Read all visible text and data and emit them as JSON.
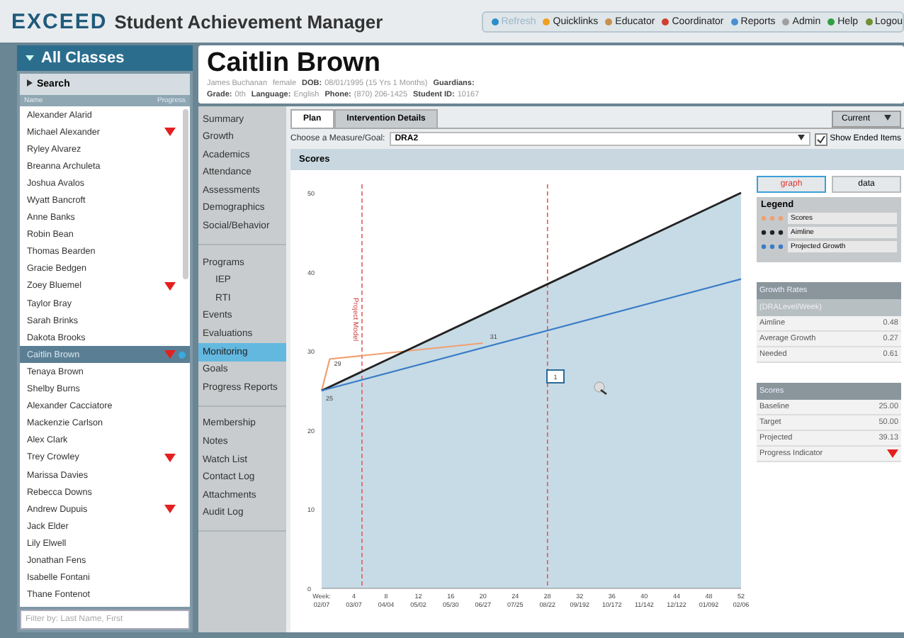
{
  "app": {
    "logo": "EXCEED",
    "title": "Student Achievement Manager"
  },
  "toolbar": [
    {
      "label": "Refresh",
      "disabled": true,
      "color": "#2a8fc8"
    },
    {
      "label": "Quicklinks",
      "disabled": false,
      "color": "#f0a020"
    },
    {
      "label": "Educator",
      "disabled": false,
      "color": "#c89050"
    },
    {
      "label": "Coordinator",
      "disabled": false,
      "color": "#d04030"
    },
    {
      "label": "Reports",
      "disabled": false,
      "color": "#4a90d0"
    },
    {
      "label": "Admin",
      "disabled": false,
      "color": "#a0a0a0"
    },
    {
      "label": "Help",
      "disabled": false,
      "color": "#30a040"
    },
    {
      "label": "Logou",
      "disabled": false,
      "color": "#709030"
    }
  ],
  "sidebar": {
    "title": "All Classes",
    "search": "Search",
    "columns": [
      "Name",
      "Progress"
    ],
    "students": [
      {
        "name": "Alexander Alarid",
        "progress_down": false,
        "selected": false
      },
      {
        "name": "Michael Alexander",
        "progress_down": true,
        "selected": false
      },
      {
        "name": "Ryley Alvarez",
        "progress_down": false,
        "selected": false
      },
      {
        "name": "Breanna Archuleta",
        "progress_down": false,
        "selected": false
      },
      {
        "name": "Joshua Avalos",
        "progress_down": false,
        "selected": false
      },
      {
        "name": "Wyatt Bancroft",
        "progress_down": false,
        "selected": false
      },
      {
        "name": "Anne Banks",
        "progress_down": false,
        "selected": false
      },
      {
        "name": "Robin Bean",
        "progress_down": false,
        "selected": false
      },
      {
        "name": "Thomas Bearden",
        "progress_down": false,
        "selected": false
      },
      {
        "name": "Gracie Bedgen",
        "progress_down": false,
        "selected": false
      },
      {
        "name": "Zoey Bluemel",
        "progress_down": true,
        "selected": false
      },
      {
        "name": "Taylor Bray",
        "progress_down": false,
        "selected": false
      },
      {
        "name": "Sarah Brinks",
        "progress_down": false,
        "selected": false
      },
      {
        "name": "Dakota Brooks",
        "progress_down": false,
        "selected": false
      },
      {
        "name": "Caitlin Brown",
        "progress_down": true,
        "selected": true
      },
      {
        "name": "Tenaya Brown",
        "progress_down": false,
        "selected": false
      },
      {
        "name": "Shelby Burns",
        "progress_down": false,
        "selected": false
      },
      {
        "name": "Alexander Cacciatore",
        "progress_down": false,
        "selected": false
      },
      {
        "name": "Mackenzie Carlson",
        "progress_down": false,
        "selected": false
      },
      {
        "name": "Alex Clark",
        "progress_down": false,
        "selected": false
      },
      {
        "name": "Trey Crowley",
        "progress_down": true,
        "selected": false
      },
      {
        "name": "Marissa Davies",
        "progress_down": false,
        "selected": false
      },
      {
        "name": "Rebecca Downs",
        "progress_down": false,
        "selected": false
      },
      {
        "name": "Andrew Dupuis",
        "progress_down": true,
        "selected": false
      },
      {
        "name": "Jack Elder",
        "progress_down": false,
        "selected": false
      },
      {
        "name": "Lily Elwell",
        "progress_down": false,
        "selected": false
      },
      {
        "name": "Jonathan Fens",
        "progress_down": false,
        "selected": false
      },
      {
        "name": "Isabelle Fontani",
        "progress_down": false,
        "selected": false
      },
      {
        "name": "Thane Fontenot",
        "progress_down": false,
        "selected": false
      }
    ],
    "filter": {
      "placeholder": "Filter by: Last Name, First"
    }
  },
  "student": {
    "name": "Caitlin Brown",
    "info": [
      [
        {
          "value": "James Buchanan"
        },
        {
          "value": "female"
        },
        {
          "label": "DOB:",
          "value": "08/01/1995 (15 Yrs 1 Months)"
        },
        {
          "label": "Guardians:"
        }
      ],
      [
        {
          "label": "Grade:",
          "value": "0th"
        },
        {
          "label": "Language:",
          "value": "English"
        },
        {
          "label": "Phone:",
          "value": "(870) 206-1425"
        },
        {
          "label": "Student ID:",
          "value": "10167"
        }
      ]
    ]
  },
  "nav": [
    [
      {
        "label": "Summary",
        "selected": false,
        "indent": false
      },
      {
        "label": "Growth",
        "selected": false,
        "indent": false
      },
      {
        "label": "Academics",
        "selected": false,
        "indent": false
      },
      {
        "label": "Attendance",
        "selected": false,
        "indent": false
      },
      {
        "label": "Assessments",
        "selected": false,
        "indent": false
      },
      {
        "label": "Demographics",
        "selected": false,
        "indent": false
      },
      {
        "label": "Social/Behavior",
        "selected": false,
        "indent": false
      }
    ],
    [
      {
        "label": "Programs",
        "selected": false,
        "indent": false
      },
      {
        "label": "IEP",
        "selected": false,
        "indent": true
      },
      {
        "label": "RTI",
        "selected": false,
        "indent": true
      },
      {
        "label": "Events",
        "selected": false,
        "indent": false
      },
      {
        "label": "Evaluations",
        "selected": false,
        "indent": false
      },
      {
        "label": "Monitoring",
        "selected": true,
        "indent": false
      },
      {
        "label": "Goals",
        "selected": false,
        "indent": false
      },
      {
        "label": "Progress Reports",
        "selected": false,
        "indent": false
      }
    ],
    [
      {
        "label": "Membership",
        "selected": false,
        "indent": false
      },
      {
        "label": "Notes",
        "selected": false,
        "indent": false
      },
      {
        "label": "Watch List",
        "selected": false,
        "indent": false
      },
      {
        "label": "Contact Log",
        "selected": false,
        "indent": false
      },
      {
        "label": "Attachments",
        "selected": false,
        "indent": false
      },
      {
        "label": "Audit Log",
        "selected": false,
        "indent": false
      }
    ]
  ],
  "tabs": [
    {
      "label": "Plan",
      "selected": true
    },
    {
      "label": "Intervention Details",
      "selected": false
    }
  ],
  "period": {
    "value": "Current"
  },
  "measure": {
    "label": "Choose a Measure/Goal:",
    "value": "DRA2"
  },
  "show_ended": {
    "label": "Show Ended Items",
    "checked": true
  },
  "section_title": "Scores",
  "chart_data": {
    "type": "line",
    "x": [
      0,
      1,
      20,
      52
    ],
    "series": [
      {
        "name": "Scores",
        "color": "#f0a070",
        "values": [
          25,
          29,
          31,
          null
        ],
        "data_labels": true
      },
      {
        "name": "Aimline",
        "type": "area",
        "color": "#222222",
        "values": [
          25,
          null,
          null,
          50
        ],
        "data_labels": false
      },
      {
        "name": "Projected Growth",
        "color": "#3a7cc8",
        "values": [
          25,
          null,
          null,
          39.1
        ],
        "data_labels": false
      }
    ],
    "xlabel": "Week:",
    "xlim": [
      0,
      52
    ],
    "ylim": [
      0,
      50
    ],
    "yticks": [
      0,
      10,
      20,
      30,
      40,
      50
    ],
    "xticks": [
      4,
      8,
      12,
      16,
      20,
      24,
      28,
      32,
      36,
      40,
      44,
      48,
      52
    ],
    "ref_lines": [
      {
        "axis": "x",
        "value": 5,
        "label": "Project Model"
      },
      {
        "axis": "x",
        "value": 28
      }
    ],
    "annotations": [
      "1"
    ]
  },
  "week_dates": [
    "02/07",
    "03/07",
    "04/04",
    "05/02",
    "05/30",
    "06/27",
    "07/25",
    "08/22",
    "09/192",
    "10/172",
    "11/142",
    "12/122",
    "01/092",
    "02/06"
  ],
  "view_toggle": [
    {
      "label": "graph",
      "selected": true
    },
    {
      "label": "data",
      "selected": false
    }
  ],
  "legend": {
    "title": "Legend"
  },
  "growth_rates": {
    "title": "Growth Rates",
    "unit": "(DRALevel/Week)",
    "rows": [
      {
        "label": "Aimline",
        "value": "0.48"
      },
      {
        "label": "Average Growth",
        "value": "0.27"
      },
      {
        "label": "Needed",
        "value": "0.61"
      }
    ]
  },
  "scores": {
    "title": "Scores",
    "rows": [
      {
        "kind": "value",
        "label": "Baseline",
        "value": "25.00"
      },
      {
        "kind": "value",
        "label": "Target",
        "value": "50.00"
      },
      {
        "kind": "value",
        "label": "Projected",
        "value": "39.13"
      },
      {
        "kind": "indicator",
        "label": "Progress Indicator",
        "down": true
      }
    ]
  }
}
